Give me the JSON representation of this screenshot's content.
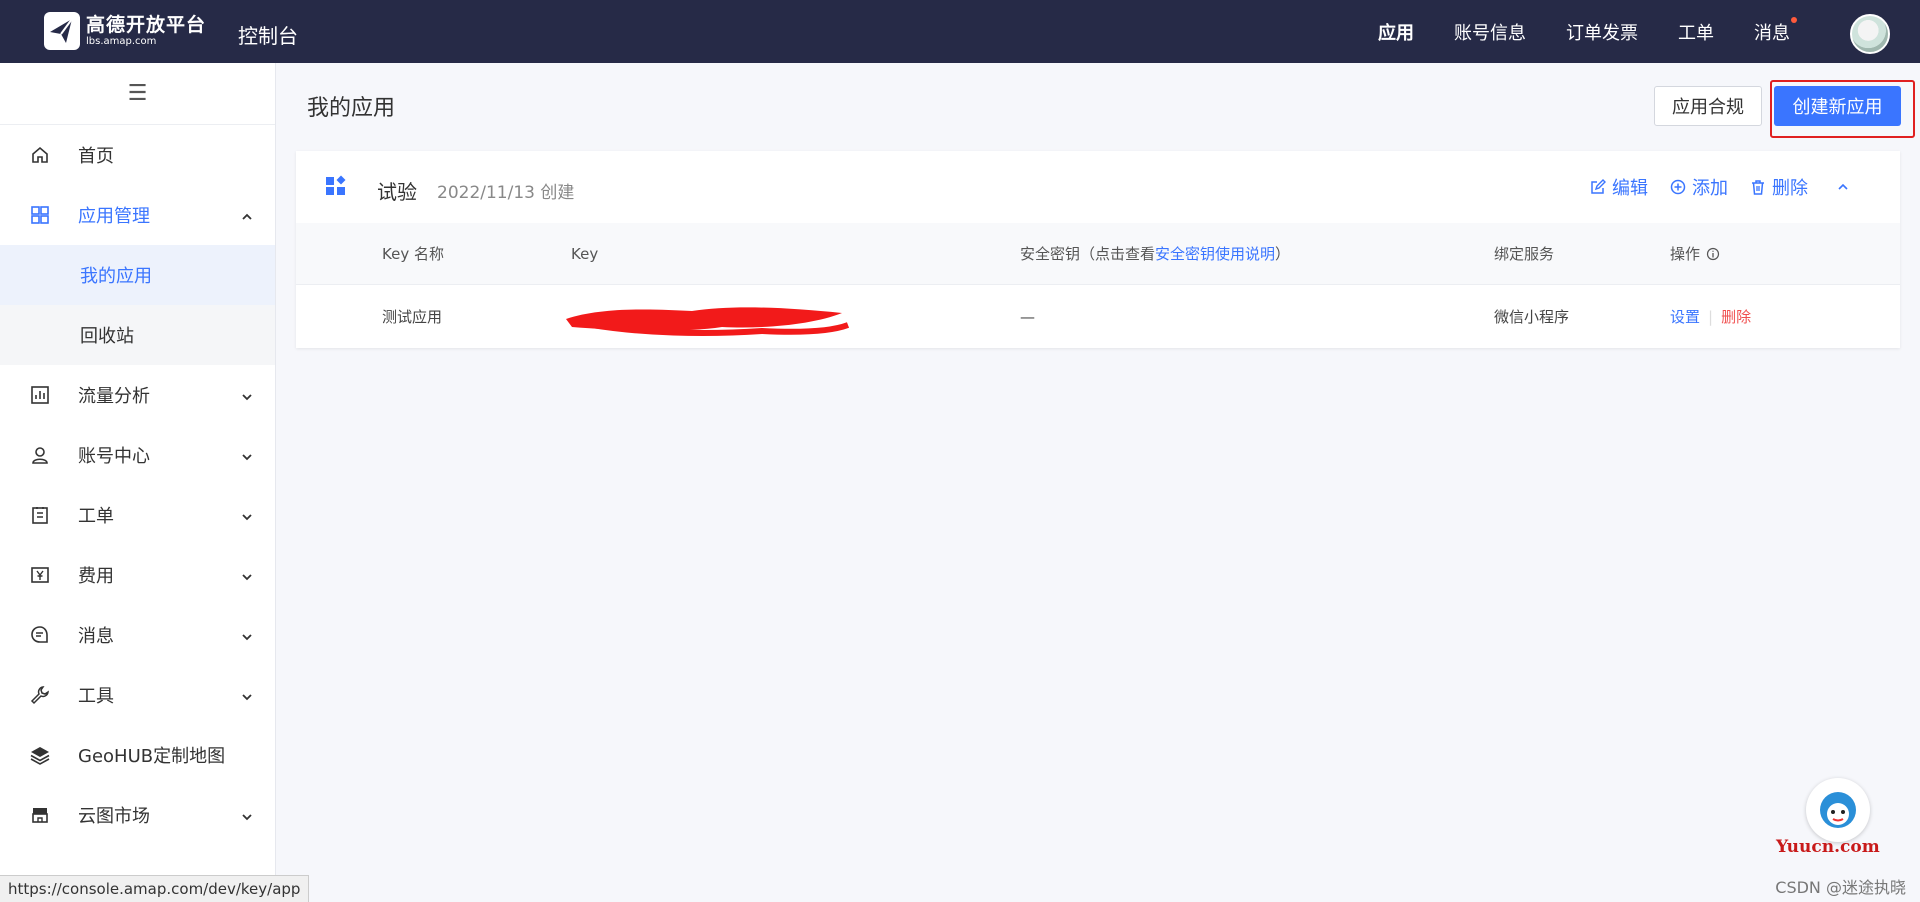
{
  "topbar": {
    "logo_cn": "高德开放平台",
    "logo_en": "lbs.amap.com",
    "console_title": "控制台",
    "nav": [
      {
        "label": "应用"
      },
      {
        "label": "账号信息"
      },
      {
        "label": "订单发票"
      },
      {
        "label": "工单"
      },
      {
        "label": "消息"
      }
    ]
  },
  "sidebar": {
    "items": [
      {
        "label": "首页",
        "icon": "home-icon"
      },
      {
        "label": "应用管理",
        "icon": "grid-icon"
      },
      {
        "label": "我的应用"
      },
      {
        "label": "回收站"
      },
      {
        "label": "流量分析",
        "icon": "chart-icon"
      },
      {
        "label": "账号中心",
        "icon": "user-icon"
      },
      {
        "label": "工单",
        "icon": "clipboard-icon"
      },
      {
        "label": "费用",
        "icon": "yen-icon"
      },
      {
        "label": "消息",
        "icon": "message-icon"
      },
      {
        "label": "工具",
        "icon": "wrench-icon"
      },
      {
        "label": "GeoHUB定制地图",
        "icon": "layers-icon"
      },
      {
        "label": "云图市场",
        "icon": "store-icon"
      }
    ]
  },
  "main": {
    "title": "我的应用",
    "compliance_button": "应用合规",
    "create_button": "创建新应用",
    "app": {
      "name": "试验",
      "created": "2022/11/13 创建",
      "actions": {
        "edit": "编辑",
        "add": "添加",
        "delete": "删除"
      }
    },
    "table": {
      "headers": {
        "key_name": "Key 名称",
        "key": "Key",
        "secret_prefix": "安全密钥（点击查看",
        "secret_link": "安全密钥使用说明",
        "secret_suffix": "）",
        "service": "绑定服务",
        "ops": "操作"
      },
      "rows": [
        {
          "key_name": "测试应用",
          "secret": "—",
          "service": "微信小程序",
          "setting": "设置",
          "delete": "删除"
        }
      ]
    }
  },
  "statusbar_url": "https://console.amap.com/dev/key/app",
  "watermark": "CSDN @迷途执晓",
  "yuucn": "Yuucn.com",
  "colors": {
    "accent": "#3a75ff",
    "topbar": "#262a47",
    "danger": "#f05050",
    "highlight_box": "#e02020"
  }
}
